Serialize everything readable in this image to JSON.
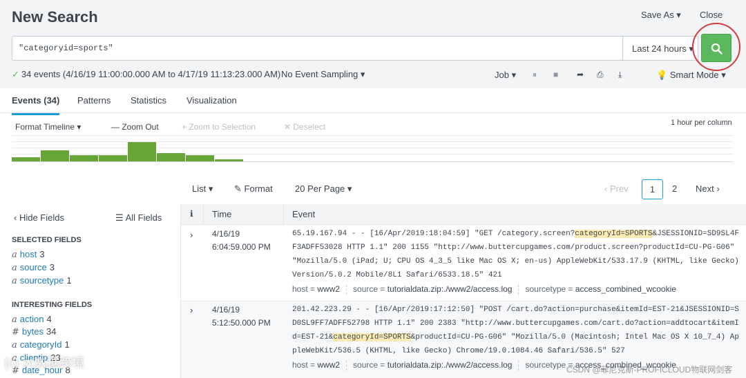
{
  "header": {
    "title": "New Search",
    "save_as": "Save As ▾",
    "close": "Close"
  },
  "search": {
    "query": "\"categoryid=sports\"",
    "time_range": "Last 24 hours ▾"
  },
  "status": {
    "events_summary": "34 events (4/16/19 11:00:00.000 AM to 4/17/19 11:13:23.000 AM)",
    "sampling": "No Event Sampling ▾",
    "job": "Job ▾",
    "mode": "Smart Mode ▾"
  },
  "tabs": [
    {
      "label": "Events (34)",
      "active": true
    },
    {
      "label": "Patterns"
    },
    {
      "label": "Statistics"
    },
    {
      "label": "Visualization"
    }
  ],
  "timeline": {
    "format": "Format Timeline ▾",
    "zoom_out": "— Zoom Out",
    "zoom_selection": "+ Zoom to Selection",
    "deselect": "✕ Deselect",
    "scale": "1 hour per column",
    "bar_levels": [
      0.18,
      0.45,
      0.25,
      0.25,
      0.78,
      0.33,
      0.25,
      0.08
    ]
  },
  "results_bar": {
    "list": "List ▾",
    "format": "Format",
    "per_page": "20 Per Page ▾",
    "prev": "‹ Prev",
    "current_page": "1",
    "page2": "2",
    "next": "Next ›"
  },
  "sidebar": {
    "hide_fields": "Hide Fields",
    "all_fields": "All Fields",
    "selected_title": "SELECTED FIELDS",
    "selected": [
      {
        "type": "a",
        "name": "host",
        "count": "3"
      },
      {
        "type": "a",
        "name": "source",
        "count": "3"
      },
      {
        "type": "a",
        "name": "sourcetype",
        "count": "1"
      }
    ],
    "interesting_title": "INTERESTING FIELDS",
    "interesting": [
      {
        "type": "a",
        "name": "action",
        "count": "4"
      },
      {
        "type": "#",
        "name": "bytes",
        "count": "34"
      },
      {
        "type": "a",
        "name": "categoryId",
        "count": "1"
      },
      {
        "type": "a",
        "name": "clientip",
        "count": "23"
      },
      {
        "type": "#",
        "name": "date_hour",
        "count": "8"
      }
    ]
  },
  "table": {
    "col_info": "i",
    "col_time": "Time",
    "col_event": "Event",
    "rows": [
      {
        "date": "4/16/19",
        "time": "6:04:59.000 PM",
        "event_pre": "65.19.167.94 - - [16/Apr/2019:18:04:59] \"GET /category.screen?",
        "event_hl": "categoryId=SPORTS",
        "event_post": "&JSESSIONID=SD9SL4FF3ADFF53028 HTTP 1.1\" 200 1155 \"http://www.buttercupgames.com/product.screen?productId=CU-PG-G06\" \"Mozilla/5.0 (iPad; U; CPU OS 4_3_5 like Mac OS X; en-us) AppleWebKit/533.17.9 (KHTML, like Gecko) Version/5.0.2 Mobile/8L1 Safari/6533.18.5\" 421",
        "host": "www2",
        "source": "tutorialdata.zip:./www2/access.log",
        "sourcetype": "access_combined_wcookie"
      },
      {
        "date": "4/16/19",
        "time": "5:12:50.000 PM",
        "event_pre": "201.42.223.29 - - [16/Apr/2019:17:12:50] \"POST /cart.do?action=purchase&itemId=EST-21&JSESSIONID=SD0SL9FF7ADFF52798 HTTP 1.1\" 200 2383 \"http://www.buttercupgames.com/cart.do?action=addtocart&itemId=EST-21&",
        "event_hl": "categoryId=SPORTS",
        "event_post": "&productId=CU-PG-G06\" \"Mozilla/5.0 (Macintosh; Intel Mac OS X 10_7_4) AppleWebKit/536.5 (KHTML, like Gecko) Chrome/19.0.1084.46 Safari/536.5\" 527",
        "host": "www2",
        "source": "tutorialdata.zip:./www2/access.log",
        "sourcetype": "access_combined_wcookie"
      }
    ],
    "meta_labels": {
      "host": "host = ",
      "source": "source = ",
      "sourcetype": "sourcetype = "
    }
  },
  "watermarks": {
    "left": "(c) 大数据跨境",
    "right": "CSDN @菲尼克斯-PROFICLOUD物联网剑客"
  },
  "colors": {
    "accent": "#1a9cd9",
    "search_button": "#5cb85c",
    "timeline_bar": "#65a637",
    "highlight": "#fde9b2"
  }
}
